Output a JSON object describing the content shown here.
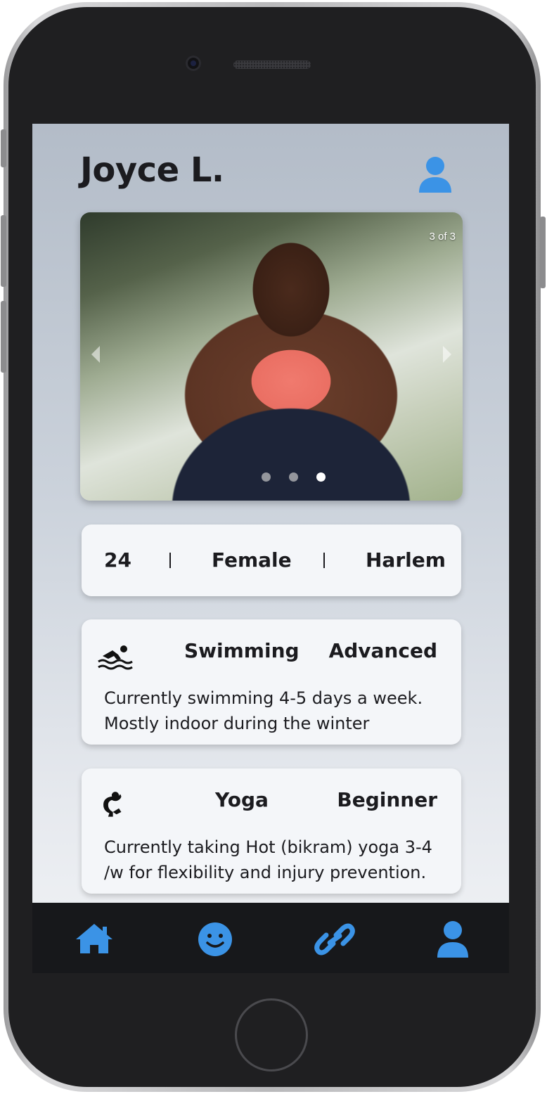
{
  "profile": {
    "name": "Joyce L."
  },
  "carousel": {
    "counter": "3 of 3",
    "current": 3,
    "total": 3
  },
  "info": {
    "age": "24",
    "gender": "Female",
    "location": "Harlem"
  },
  "activities": [
    {
      "icon": "swimmer-icon",
      "name": "Swimming",
      "level": "Advanced",
      "description": "Currently swimming 4-5 days a week. Mostly indoor during the winter"
    },
    {
      "icon": "yoga-pose-icon",
      "name": "Yoga",
      "level": "Beginner",
      "description": "Currently taking Hot (bikram) yoga 3-4 /w for flexibility and injury prevention."
    }
  ],
  "nav": {
    "items": [
      "home-icon",
      "smiley-icon",
      "link-icon",
      "user-icon"
    ]
  },
  "colors": {
    "accent": "#3b93e6",
    "nav_bg": "#17181b",
    "card_bg": "#f4f6f9",
    "text": "#1b1b1f"
  }
}
